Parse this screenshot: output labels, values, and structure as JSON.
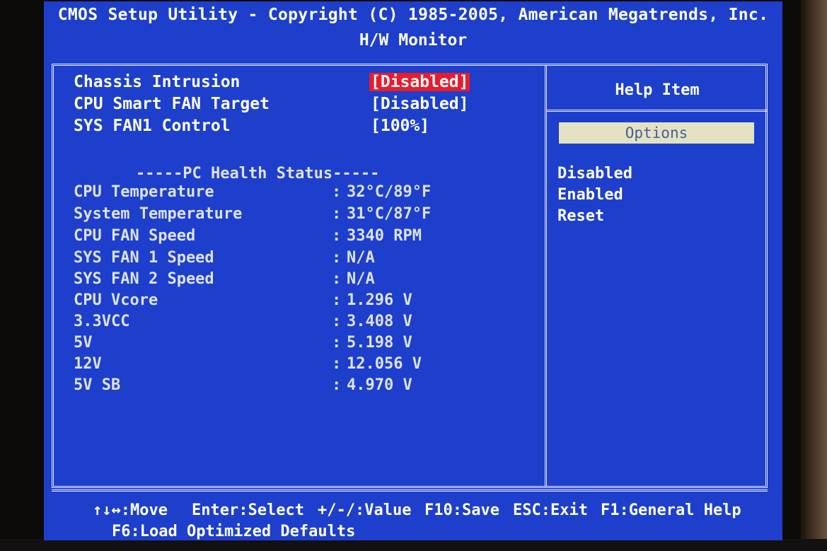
{
  "header": {
    "title": "CMOS Setup Utility - Copyright (C) 1985-2005, American Megatrends, Inc.",
    "subtitle": "H/W Monitor"
  },
  "settings": [
    {
      "label": "Chassis Intrusion",
      "value": "[Disabled]",
      "selected": true
    },
    {
      "label": "CPU Smart FAN Target",
      "value": "[Disabled]",
      "selected": false
    },
    {
      "label": "SYS FAN1 Control",
      "value": "[100%]",
      "selected": false
    }
  ],
  "health": {
    "heading": "-----PC Health Status-----",
    "separator": ":",
    "items": [
      {
        "label": "CPU Temperature",
        "value": "32°C/89°F"
      },
      {
        "label": "System Temperature",
        "value": "31°C/87°F"
      },
      {
        "label": "CPU FAN Speed",
        "value": "3340 RPM"
      },
      {
        "label": "SYS FAN 1 Speed",
        "value": "N/A"
      },
      {
        "label": "SYS FAN 2 Speed",
        "value": "N/A"
      },
      {
        "label": "CPU Vcore",
        "value": "1.296 V"
      },
      {
        "label": "3.3VCC",
        "value": "3.408 V"
      },
      {
        "label": "5V",
        "value": "5.198 V"
      },
      {
        "label": "12V",
        "value": "12.056 V"
      },
      {
        "label": "5V SB",
        "value": "4.970 V"
      }
    ]
  },
  "help": {
    "title": "Help Item",
    "options_label": "Options",
    "options": [
      "Disabled",
      "Enabled",
      "Reset"
    ]
  },
  "keys": {
    "move": "↑↓↔:Move",
    "select": "Enter:Select",
    "value": "+/-/:Value",
    "save": "F10:Save",
    "exit": "ESC:Exit",
    "general_help": "F1:General Help",
    "load_defaults": "F6:Load Optimized Defaults"
  },
  "colors": {
    "screen_bg": "#1d3fcb",
    "selected_bg": "#e81c2b",
    "options_bar": "#e3e3c4"
  }
}
